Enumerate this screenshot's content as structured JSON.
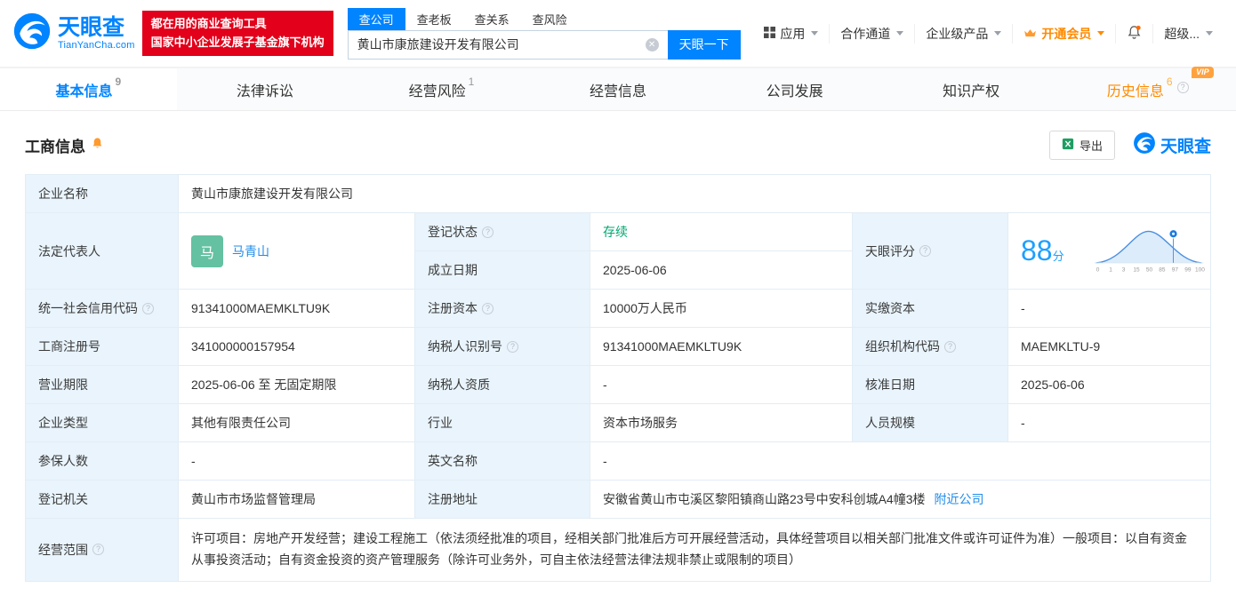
{
  "brand": {
    "logo_text": "天眼查",
    "logo_sub": "TianYanCha.com",
    "slogan_line1": "都在用的商业查询工具",
    "slogan_line2": "国家中小企业发展子基金旗下机构"
  },
  "search": {
    "tabs": [
      {
        "label": "查公司"
      },
      {
        "label": "查老板"
      },
      {
        "label": "查关系"
      },
      {
        "label": "查风险"
      }
    ],
    "value": "黄山市康旅建设开发有限公司",
    "button_label": "天眼一下"
  },
  "top_nav": {
    "apps": "应用",
    "cooperation": "合作通道",
    "enterprise": "企业级产品",
    "vip": "开通会员",
    "account": "超级..."
  },
  "page_tabs": [
    {
      "label": "基本信息",
      "badge": "9"
    },
    {
      "label": "法律诉讼",
      "badge": ""
    },
    {
      "label": "经营风险",
      "badge": "1"
    },
    {
      "label": "经营信息",
      "badge": ""
    },
    {
      "label": "公司发展",
      "badge": ""
    },
    {
      "label": "知识产权",
      "badge": ""
    },
    {
      "label": "历史信息",
      "badge": "6",
      "vip_tag": "VIP"
    }
  ],
  "section": {
    "title": "工商信息",
    "export_label": "导出",
    "brand_mark": "天眼查"
  },
  "score": {
    "label": "天眼评分",
    "value": "88",
    "unit": "分",
    "axis": [
      "0",
      "1",
      "3",
      "15",
      "50",
      "85",
      "97",
      "99",
      "100"
    ]
  },
  "fields": {
    "company_name": {
      "label": "企业名称",
      "value": "黄山市康旅建设开发有限公司"
    },
    "legal_rep": {
      "label": "法定代表人",
      "avatar": "马",
      "value": "马青山"
    },
    "reg_status": {
      "label": "登记状态",
      "value": "存续"
    },
    "establish_date": {
      "label": "成立日期",
      "value": "2025-06-06"
    },
    "credit_code": {
      "label": "统一社会信用代码",
      "value": "91341000MAEMKLTU9K"
    },
    "reg_capital": {
      "label": "注册资本",
      "value": "10000万人民币"
    },
    "paid_capital": {
      "label": "实缴资本",
      "value": "-"
    },
    "reg_number": {
      "label": "工商注册号",
      "value": "341000000157954"
    },
    "taxpayer_id": {
      "label": "纳税人识别号",
      "value": "91341000MAEMKLTU9K"
    },
    "org_code": {
      "label": "组织机构代码",
      "value": "MAEMKLTU-9"
    },
    "business_term": {
      "label": "营业期限",
      "value": "2025-06-06 至 无固定期限"
    },
    "taxpayer_quality": {
      "label": "纳税人资质",
      "value": "-"
    },
    "approval_date": {
      "label": "核准日期",
      "value": "2025-06-06"
    },
    "company_type": {
      "label": "企业类型",
      "value": "其他有限责任公司"
    },
    "industry": {
      "label": "行业",
      "value": "资本市场服务"
    },
    "staff_size": {
      "label": "人员规模",
      "value": "-"
    },
    "insured_count": {
      "label": "参保人数",
      "value": "-"
    },
    "english_name": {
      "label": "英文名称",
      "value": "-"
    },
    "reg_authority": {
      "label": "登记机关",
      "value": "黄山市市场监督管理局"
    },
    "reg_address": {
      "label": "注册地址",
      "value": "安徽省黄山市屯溪区黎阳镇商山路23号中安科创城A4幢3楼",
      "link": "附近公司"
    },
    "business_scope": {
      "label": "经营范围",
      "value": "许可项目：房地产开发经营；建设工程施工（依法须经批准的项目，经相关部门批准后方可开展经营活动，具体经营项目以相关部门批准文件或许可证件为准）一般项目：以自有资金从事投资活动；自有资金投资的资产管理服务（除许可业务外，可自主依法经营法律法规非禁止或限制的项目）"
    }
  },
  "colors": {
    "brand_blue": "#0084ff",
    "vip_orange": "#ff8a00",
    "status_green": "#00a870",
    "brand_red": "#e2001a"
  }
}
